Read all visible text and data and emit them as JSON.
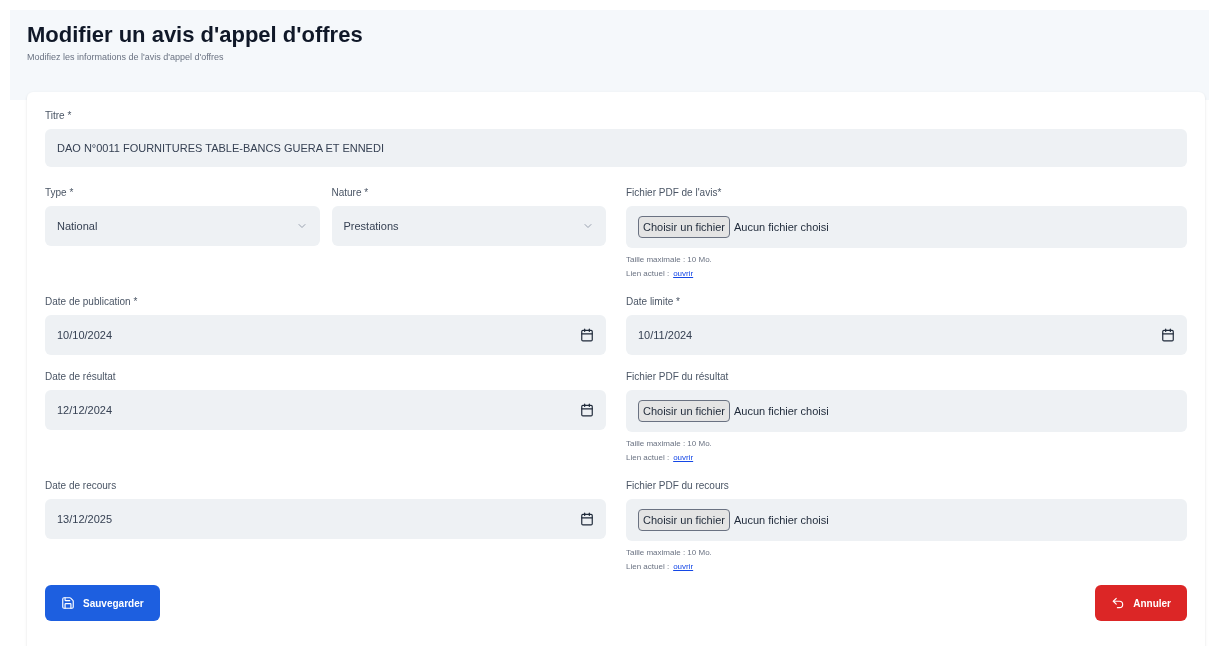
{
  "header": {
    "title": "Modifier un avis d'appel d'offres",
    "subtitle": "Modifiez les informations de l'avis d'appel d'offres"
  },
  "title_field": {
    "label": "Titre *",
    "value": "DAO N°0011 FOURNITURES TABLE-BANCS GUERA ET ENNEDI"
  },
  "rows": [
    {
      "left": [
        {
          "kind": "select",
          "label": "Type *",
          "value": "National"
        },
        {
          "kind": "select",
          "label": "Nature *",
          "value": "Prestations"
        }
      ],
      "right": {
        "kind": "file",
        "label": "Fichier PDF de l'avis*",
        "button": "Choisir un fichier",
        "status": "Aucun fichier choisi",
        "hint": "Taille maximale : 10 Mo.",
        "current_label": "Lien actuel :",
        "current_link": "ouvrir"
      }
    },
    {
      "left": [
        {
          "kind": "date",
          "label": "Date de publication *",
          "value": "10/10/2024"
        }
      ],
      "right": {
        "kind": "date",
        "label": "Date limite *",
        "value": "10/11/2024"
      }
    },
    {
      "left": [
        {
          "kind": "date",
          "label": "Date de résultat",
          "value": "12/12/2024"
        }
      ],
      "right": {
        "kind": "file",
        "label": "Fichier PDF du résultat",
        "button": "Choisir un fichier",
        "status": "Aucun fichier choisi",
        "hint": "Taille maximale : 10 Mo.",
        "current_label": "Lien actuel :",
        "current_link": "ouvrir"
      }
    },
    {
      "left": [
        {
          "kind": "date",
          "label": "Date de recours",
          "value": "13/12/2025"
        }
      ],
      "right": {
        "kind": "file",
        "label": "Fichier PDF du recours",
        "button": "Choisir un fichier",
        "status": "Aucun fichier choisi",
        "hint": "Taille maximale : 10 Mo.",
        "current_label": "Lien actuel :",
        "current_link": "ouvrir"
      }
    }
  ],
  "actions": {
    "save": "Sauvegarder",
    "cancel": "Annuler"
  }
}
